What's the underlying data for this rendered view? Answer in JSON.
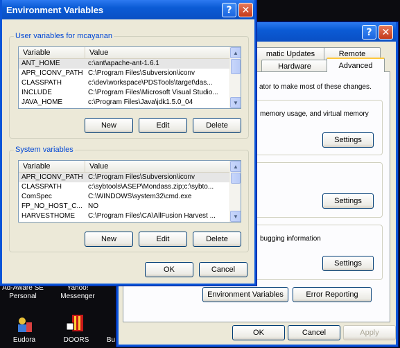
{
  "back_window": {
    "tabs_row1": [
      "matic Updates",
      "Remote"
    ],
    "tabs_row2": [
      "Hardware",
      "Advanced"
    ],
    "intro_text": "ator to make most of these changes.",
    "performance_text": "memory usage, and virtual memory",
    "startup_text": "bugging information",
    "settings_label": "Settings",
    "env_vars_button": "Environment Variables",
    "error_reporting_button": "Error Reporting",
    "ok": "OK",
    "cancel": "Cancel",
    "apply": "Apply"
  },
  "dialog": {
    "title": "Environment Variables",
    "user_group_label": "User variables for mcayanan",
    "system_group_label": "System variables",
    "col_variable": "Variable",
    "col_value": "Value",
    "user_vars": [
      {
        "name": "ANT_HOME",
        "value": "c:\\ant\\apache-ant-1.6.1"
      },
      {
        "name": "APR_ICONV_PATH",
        "value": "C:\\Program Files\\Subversion\\iconv"
      },
      {
        "name": "CLASSPATH",
        "value": "c:\\dev\\workspace\\PDSTools\\target\\das..."
      },
      {
        "name": "INCLUDE",
        "value": "C:\\Program Files\\Microsoft Visual Studio..."
      },
      {
        "name": "JAVA_HOME",
        "value": "c:\\Program Files\\Java\\jdk1.5.0_04"
      }
    ],
    "system_vars": [
      {
        "name": "APR_ICONV_PATH",
        "value": "C:\\Program Files\\Subversion\\iconv"
      },
      {
        "name": "CLASSPATH",
        "value": "c:\\sybtools\\ASEP\\Mondass.zip;c:\\sybto..."
      },
      {
        "name": "ComSpec",
        "value": "C:\\WINDOWS\\system32\\cmd.exe"
      },
      {
        "name": "FP_NO_HOST_C...",
        "value": "NO"
      },
      {
        "name": "HARVESTHOME",
        "value": "C:\\Program Files\\CA\\AllFusion Harvest ..."
      }
    ],
    "new": "New",
    "edit": "Edit",
    "delete": "Delete",
    "ok": "OK",
    "cancel": "Cancel"
  },
  "desktop": {
    "icons": [
      {
        "label": "Ad-Aware SE Personal"
      },
      {
        "label": "Yahoo! Messenger"
      },
      {
        "label": "Eudora"
      },
      {
        "label": "DOORS"
      },
      {
        "label": "Bu"
      }
    ]
  }
}
